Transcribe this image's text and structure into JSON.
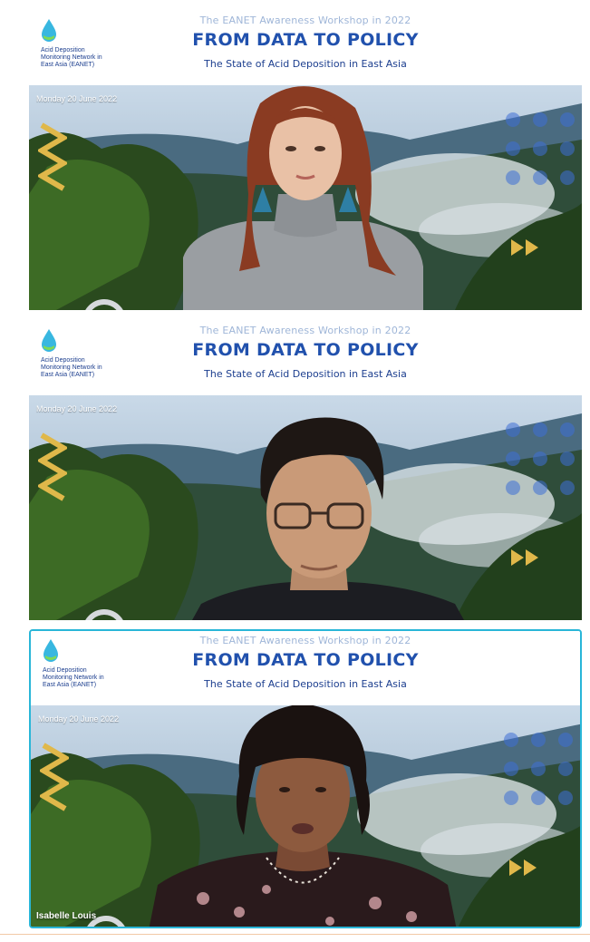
{
  "gallery": {
    "tiles": [
      {
        "logo_text": "Acid Deposition Monitoring Network in East Asia (EANET)",
        "workshop_title": "The EANET Awareness Workshop in 2022",
        "main_title": "FROM DATA TO POLICY",
        "subtitle": "The State of Acid Deposition in East Asia",
        "date": "Monday 20 June 2022",
        "participant_name": "",
        "active_speaker": false
      },
      {
        "logo_text": "Acid Deposition Monitoring Network in East Asia (EANET)",
        "workshop_title": "The EANET Awareness Workshop in 2022",
        "main_title": "FROM DATA TO POLICY",
        "subtitle": "The State of Acid Deposition in East Asia",
        "date": "Monday 20 June 2022",
        "participant_name": "",
        "active_speaker": false
      },
      {
        "logo_text": "Acid Deposition Monitoring Network in East Asia (EANET)",
        "workshop_title": "The EANET Awareness Workshop in 2022",
        "main_title": "FROM DATA TO POLICY",
        "subtitle": "The State of Acid Deposition in East Asia",
        "date": "Monday 20 June 2022",
        "participant_name": "Isabelle Louis",
        "active_speaker": true
      }
    ]
  },
  "colors": {
    "title_blue": "#2151ad",
    "active_border": "#29b6d8",
    "logo_drop": "#38b7e0",
    "accent_yellow": "#e0b84a"
  },
  "icons": {
    "logo": "water-drop-icon"
  }
}
